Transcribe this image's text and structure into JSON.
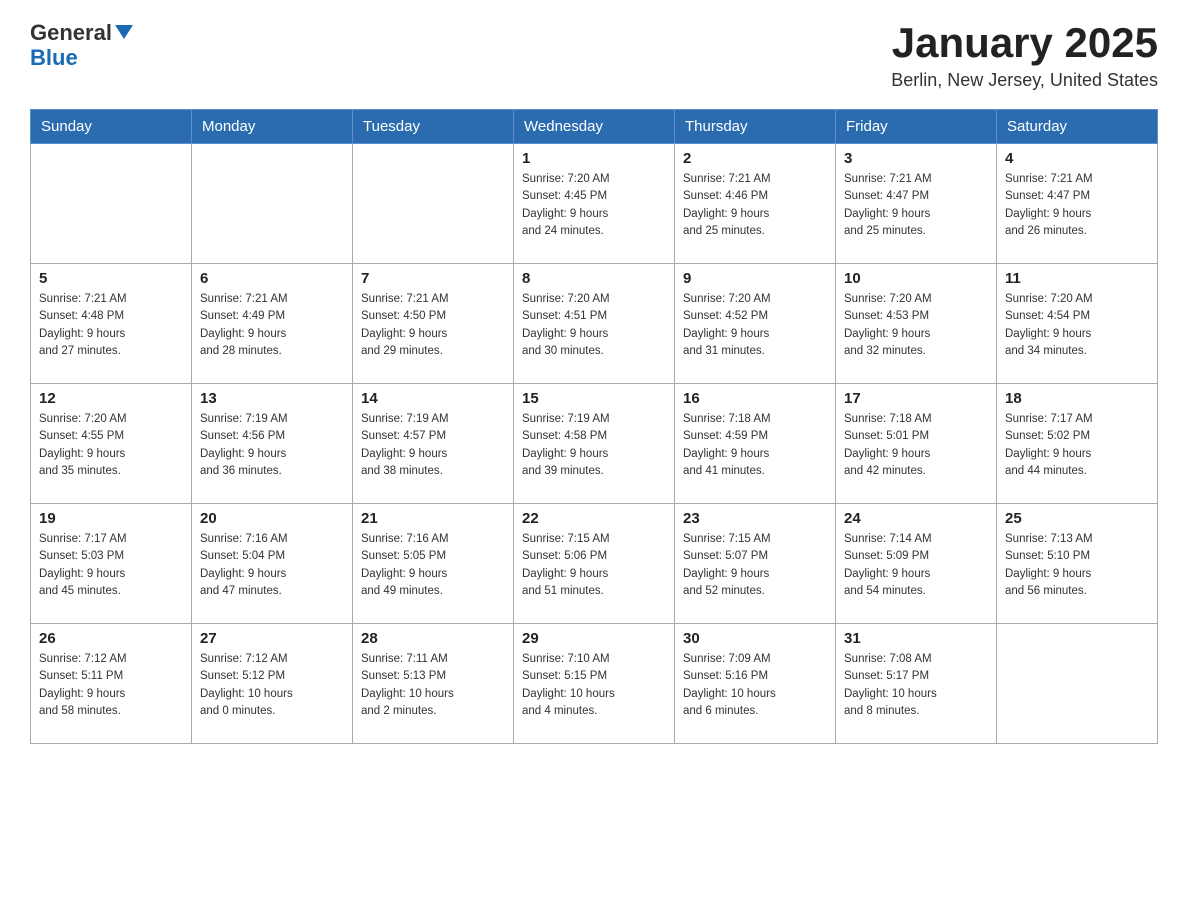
{
  "header": {
    "logo_general": "General",
    "logo_blue": "Blue",
    "month_title": "January 2025",
    "location": "Berlin, New Jersey, United States"
  },
  "weekdays": [
    "Sunday",
    "Monday",
    "Tuesday",
    "Wednesday",
    "Thursday",
    "Friday",
    "Saturday"
  ],
  "weeks": [
    [
      {
        "day": "",
        "info": ""
      },
      {
        "day": "",
        "info": ""
      },
      {
        "day": "",
        "info": ""
      },
      {
        "day": "1",
        "info": "Sunrise: 7:20 AM\nSunset: 4:45 PM\nDaylight: 9 hours\nand 24 minutes."
      },
      {
        "day": "2",
        "info": "Sunrise: 7:21 AM\nSunset: 4:46 PM\nDaylight: 9 hours\nand 25 minutes."
      },
      {
        "day": "3",
        "info": "Sunrise: 7:21 AM\nSunset: 4:47 PM\nDaylight: 9 hours\nand 25 minutes."
      },
      {
        "day": "4",
        "info": "Sunrise: 7:21 AM\nSunset: 4:47 PM\nDaylight: 9 hours\nand 26 minutes."
      }
    ],
    [
      {
        "day": "5",
        "info": "Sunrise: 7:21 AM\nSunset: 4:48 PM\nDaylight: 9 hours\nand 27 minutes."
      },
      {
        "day": "6",
        "info": "Sunrise: 7:21 AM\nSunset: 4:49 PM\nDaylight: 9 hours\nand 28 minutes."
      },
      {
        "day": "7",
        "info": "Sunrise: 7:21 AM\nSunset: 4:50 PM\nDaylight: 9 hours\nand 29 minutes."
      },
      {
        "day": "8",
        "info": "Sunrise: 7:20 AM\nSunset: 4:51 PM\nDaylight: 9 hours\nand 30 minutes."
      },
      {
        "day": "9",
        "info": "Sunrise: 7:20 AM\nSunset: 4:52 PM\nDaylight: 9 hours\nand 31 minutes."
      },
      {
        "day": "10",
        "info": "Sunrise: 7:20 AM\nSunset: 4:53 PM\nDaylight: 9 hours\nand 32 minutes."
      },
      {
        "day": "11",
        "info": "Sunrise: 7:20 AM\nSunset: 4:54 PM\nDaylight: 9 hours\nand 34 minutes."
      }
    ],
    [
      {
        "day": "12",
        "info": "Sunrise: 7:20 AM\nSunset: 4:55 PM\nDaylight: 9 hours\nand 35 minutes."
      },
      {
        "day": "13",
        "info": "Sunrise: 7:19 AM\nSunset: 4:56 PM\nDaylight: 9 hours\nand 36 minutes."
      },
      {
        "day": "14",
        "info": "Sunrise: 7:19 AM\nSunset: 4:57 PM\nDaylight: 9 hours\nand 38 minutes."
      },
      {
        "day": "15",
        "info": "Sunrise: 7:19 AM\nSunset: 4:58 PM\nDaylight: 9 hours\nand 39 minutes."
      },
      {
        "day": "16",
        "info": "Sunrise: 7:18 AM\nSunset: 4:59 PM\nDaylight: 9 hours\nand 41 minutes."
      },
      {
        "day": "17",
        "info": "Sunrise: 7:18 AM\nSunset: 5:01 PM\nDaylight: 9 hours\nand 42 minutes."
      },
      {
        "day": "18",
        "info": "Sunrise: 7:17 AM\nSunset: 5:02 PM\nDaylight: 9 hours\nand 44 minutes."
      }
    ],
    [
      {
        "day": "19",
        "info": "Sunrise: 7:17 AM\nSunset: 5:03 PM\nDaylight: 9 hours\nand 45 minutes."
      },
      {
        "day": "20",
        "info": "Sunrise: 7:16 AM\nSunset: 5:04 PM\nDaylight: 9 hours\nand 47 minutes."
      },
      {
        "day": "21",
        "info": "Sunrise: 7:16 AM\nSunset: 5:05 PM\nDaylight: 9 hours\nand 49 minutes."
      },
      {
        "day": "22",
        "info": "Sunrise: 7:15 AM\nSunset: 5:06 PM\nDaylight: 9 hours\nand 51 minutes."
      },
      {
        "day": "23",
        "info": "Sunrise: 7:15 AM\nSunset: 5:07 PM\nDaylight: 9 hours\nand 52 minutes."
      },
      {
        "day": "24",
        "info": "Sunrise: 7:14 AM\nSunset: 5:09 PM\nDaylight: 9 hours\nand 54 minutes."
      },
      {
        "day": "25",
        "info": "Sunrise: 7:13 AM\nSunset: 5:10 PM\nDaylight: 9 hours\nand 56 minutes."
      }
    ],
    [
      {
        "day": "26",
        "info": "Sunrise: 7:12 AM\nSunset: 5:11 PM\nDaylight: 9 hours\nand 58 minutes."
      },
      {
        "day": "27",
        "info": "Sunrise: 7:12 AM\nSunset: 5:12 PM\nDaylight: 10 hours\nand 0 minutes."
      },
      {
        "day": "28",
        "info": "Sunrise: 7:11 AM\nSunset: 5:13 PM\nDaylight: 10 hours\nand 2 minutes."
      },
      {
        "day": "29",
        "info": "Sunrise: 7:10 AM\nSunset: 5:15 PM\nDaylight: 10 hours\nand 4 minutes."
      },
      {
        "day": "30",
        "info": "Sunrise: 7:09 AM\nSunset: 5:16 PM\nDaylight: 10 hours\nand 6 minutes."
      },
      {
        "day": "31",
        "info": "Sunrise: 7:08 AM\nSunset: 5:17 PM\nDaylight: 10 hours\nand 8 minutes."
      },
      {
        "day": "",
        "info": ""
      }
    ]
  ]
}
